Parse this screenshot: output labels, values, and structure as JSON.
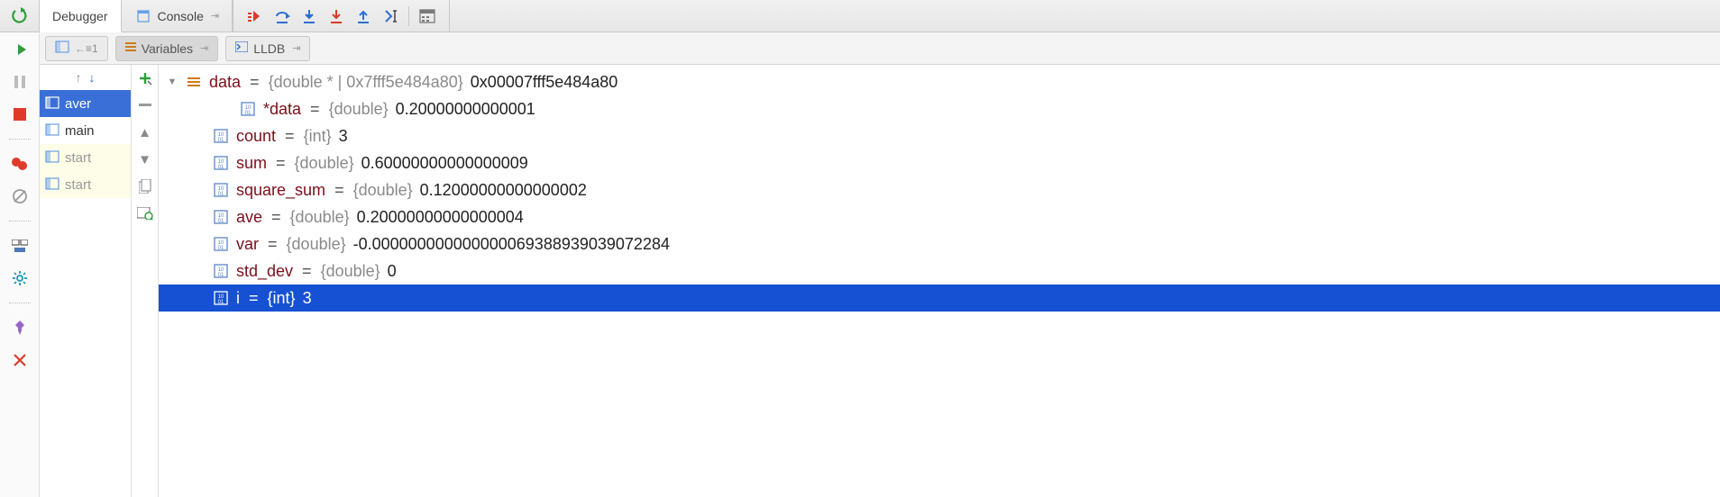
{
  "topTabs": {
    "debugger": "Debugger",
    "console": "Console"
  },
  "subTabs": {
    "variables": "Variables",
    "lldb": "LLDB"
  },
  "frames": [
    {
      "label": "aver",
      "selected": true,
      "dim": false
    },
    {
      "label": "main",
      "selected": false,
      "dim": false
    },
    {
      "label": "start",
      "selected": false,
      "dim": true
    },
    {
      "label": "start",
      "selected": false,
      "dim": true
    }
  ],
  "vars": [
    {
      "indent": 0,
      "icon": "struct",
      "twisty": "open",
      "name": "data",
      "type": "{double * | 0x7fff5e484a80}",
      "value": "0x00007fff5e484a80"
    },
    {
      "indent": 2,
      "icon": "bin",
      "twisty": "",
      "name": "*data",
      "type": "{double}",
      "value": "0.20000000000001"
    },
    {
      "indent": 1,
      "icon": "bin",
      "twisty": "",
      "name": "count",
      "type": "{int}",
      "value": "3"
    },
    {
      "indent": 1,
      "icon": "bin",
      "twisty": "",
      "name": "sum",
      "type": "{double}",
      "value": "0.60000000000000009"
    },
    {
      "indent": 1,
      "icon": "bin",
      "twisty": "",
      "name": "square_sum",
      "type": "{double}",
      "value": "0.12000000000000002"
    },
    {
      "indent": 1,
      "icon": "bin",
      "twisty": "",
      "name": "ave",
      "type": "{double}",
      "value": "0.20000000000000004"
    },
    {
      "indent": 1,
      "icon": "bin",
      "twisty": "",
      "name": "var",
      "type": "{double}",
      "value": "-0.000000000000000069388939039072284"
    },
    {
      "indent": 1,
      "icon": "bin",
      "twisty": "",
      "name": "std_dev",
      "type": "{double}",
      "value": "0"
    },
    {
      "indent": 1,
      "icon": "bin",
      "twisty": "",
      "name": "i",
      "type": "{int}",
      "value": "3",
      "selected": true
    }
  ]
}
